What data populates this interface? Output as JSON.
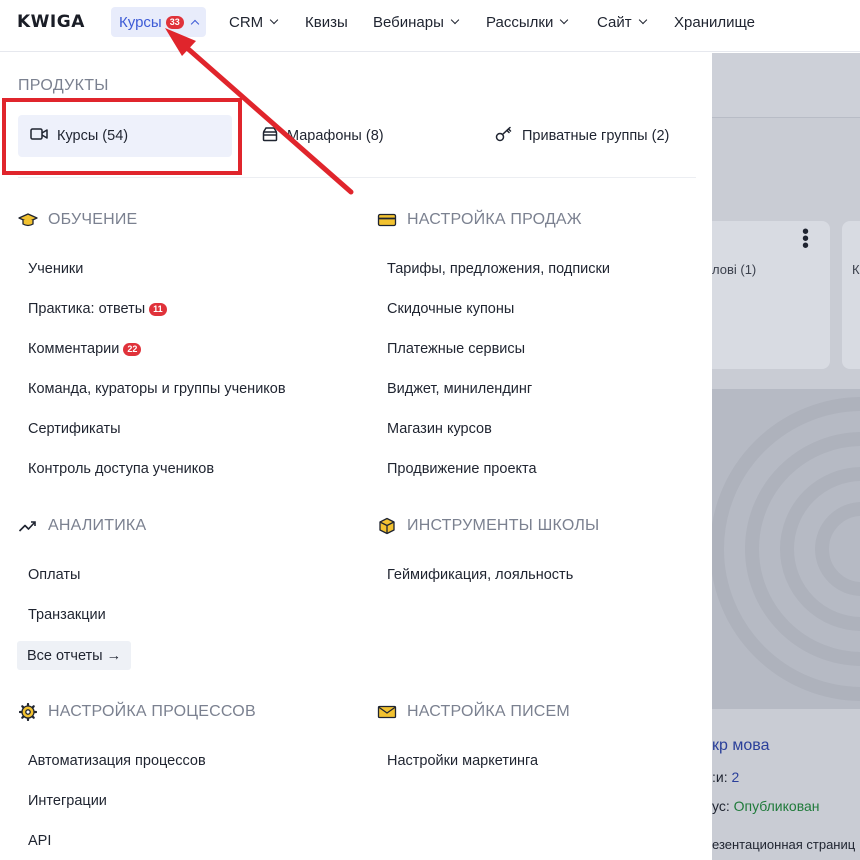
{
  "app": {
    "logo": "KWIGA"
  },
  "nav": {
    "items": [
      {
        "label": "Курсы",
        "badge": "33"
      },
      {
        "label": "CRM"
      },
      {
        "label": "Квизы"
      },
      {
        "label": "Вебинары"
      },
      {
        "label": "Рассылки"
      },
      {
        "label": "Сайт"
      },
      {
        "label": "Хранилище"
      }
    ]
  },
  "menu": {
    "products_label": "ПРОДУКТЫ",
    "products": [
      {
        "label": "Курсы (54)",
        "icon": "video-icon"
      },
      {
        "label": "Марафоны (8)",
        "icon": "box-icon"
      },
      {
        "label": "Приватные группы (2)",
        "icon": "key-icon"
      }
    ],
    "groups": {
      "learning": {
        "title": "ОБУЧЕНИЕ",
        "icon": "graduation-cap-icon",
        "items": [
          {
            "label": "Ученики"
          },
          {
            "label": "Практика: ответы",
            "badge": "11"
          },
          {
            "label": "Комментарии",
            "badge": "22"
          },
          {
            "label": "Команда, кураторы и группы учеников"
          },
          {
            "label": "Сертификаты"
          },
          {
            "label": "Контроль доступа учеников"
          }
        ]
      },
      "sales": {
        "title": "НАСТРОЙКА ПРОДАЖ",
        "icon": "credit-card-icon",
        "items": [
          {
            "label": "Тарифы, предложения, подписки"
          },
          {
            "label": "Скидочные купоны"
          },
          {
            "label": "Платежные сервисы"
          },
          {
            "label": "Виджет, минилендинг"
          },
          {
            "label": "Магазин курсов"
          },
          {
            "label": "Продвижение проекта"
          }
        ]
      },
      "analytics": {
        "title": "АНАЛИТИКА",
        "icon": "trend-up-icon",
        "items": [
          {
            "label": "Оплаты"
          },
          {
            "label": "Транзакции"
          }
        ],
        "all_reports": "Все отчеты →"
      },
      "tools": {
        "title": "ИНСТРУМЕНТЫ ШКОЛЫ",
        "icon": "cube-icon",
        "items": [
          {
            "label": "Геймификация, лояльность"
          }
        ]
      },
      "processes": {
        "title": "НАСТРОЙКА ПРОЦЕССОВ",
        "icon": "gear-icon",
        "items": [
          {
            "label": "Автоматизация процессов"
          },
          {
            "label": "Интеграции"
          },
          {
            "label": "API"
          }
        ]
      },
      "emails": {
        "title": "НАСТРОЙКА ПИСЕМ",
        "icon": "envelope-icon",
        "items": [
          {
            "label": "Настройки маркетинга"
          }
        ]
      }
    }
  },
  "background": {
    "card_text_1": "лові (1)",
    "card_text_2": "К",
    "title": "кр мова",
    "line2_prefix": ":и: ",
    "line2_value": "2",
    "line3_prefix": "ус: ",
    "line3_value": "Опубликован",
    "line4": "езентационная страниц"
  },
  "colors": {
    "accent": "#3d5bd6",
    "badge": "#e0323a",
    "annotation": "#e0252c"
  }
}
